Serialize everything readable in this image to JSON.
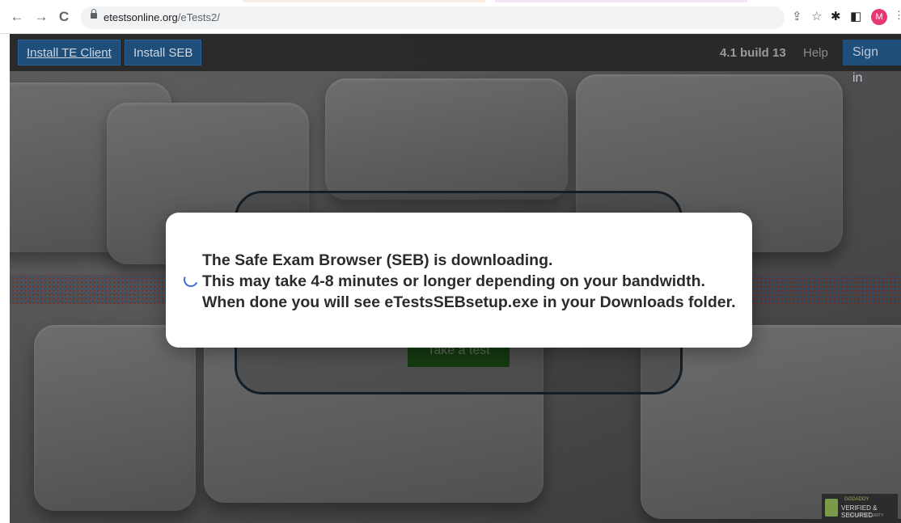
{
  "browser": {
    "url_host": "etestsonline.org",
    "url_path": "/eTests2/",
    "nav": {
      "back": "←",
      "forward": "→",
      "reload": "C"
    },
    "toolbar_icons": [
      "share-icon",
      "star-icon",
      "puzzle-icon",
      "sidepanel-icon"
    ],
    "avatar_letter": "M"
  },
  "navbar": {
    "install_te_client": "Install TE Client",
    "install_seb": "Install SEB",
    "version": "4.1 build 13",
    "help": "Help",
    "sign_in": "Sign in"
  },
  "card": {
    "take_test": "Take a test"
  },
  "modal": {
    "line1": "The Safe Exam Browser (SEB) is downloading.",
    "line2": "This may take 4-8 minutes or longer depending on your bandwidth.",
    "line3": "When done you will see eTestsSEBsetup.exe in your Downloads folder."
  },
  "badge": {
    "brand": "GODADDY",
    "text": "VERIFIED & SECURED",
    "sub": "VERIFY SECURITY"
  }
}
